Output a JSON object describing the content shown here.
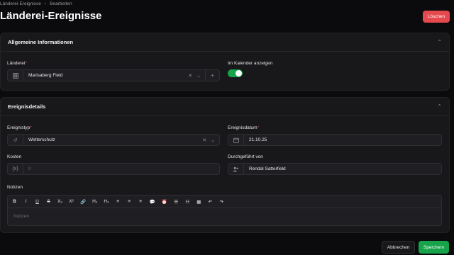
{
  "breadcrumb": {
    "items": [
      "Länderei-Ereignisse",
      "Bearbeiten"
    ],
    "separator": "›"
  },
  "header": {
    "title": "Länderei-Ereignisse",
    "delete_label": "Löschen"
  },
  "section1": {
    "title": "Allgemeine Informationen",
    "estate": {
      "label": "Länderei",
      "required_mark": "*",
      "value": "Marisaberg Field",
      "prefix_icon": "grid-icon"
    },
    "calendar": {
      "label": "Im Kalender anzeigen",
      "checked": true
    }
  },
  "section2": {
    "title": "Ereignisdetails",
    "event_type": {
      "label": "Ereignistyp",
      "required_mark": "*",
      "value": "Wetterschutz",
      "prefix_icon": "history-icon"
    },
    "event_date": {
      "label": "Ereignisdatum",
      "required_mark": "*",
      "value": "21.10.25",
      "prefix_icon": "calendar-icon"
    },
    "costs": {
      "label": "Kosten",
      "value": "0",
      "prefix": "{x}"
    },
    "performed_by": {
      "label": "Durchgeführt von",
      "value": "Rendal Satterfield",
      "prefix_icon": "users-icon"
    },
    "notes": {
      "label": "Notizen",
      "placeholder": "Notizen"
    }
  },
  "toolbar": [
    "B",
    "I",
    "U",
    "S",
    "X₂",
    "X²",
    "🔗",
    "H₂",
    "H₃",
    "≡",
    "≡",
    "≡",
    "💬",
    "⏰",
    "☰",
    "☷",
    "▦",
    "↶",
    "↷"
  ],
  "footer": {
    "cancel_label": "Abbrechen",
    "save_label": "Speichern"
  },
  "colors": {
    "accent_green": "#16a34a",
    "danger_red": "#e5484d"
  }
}
